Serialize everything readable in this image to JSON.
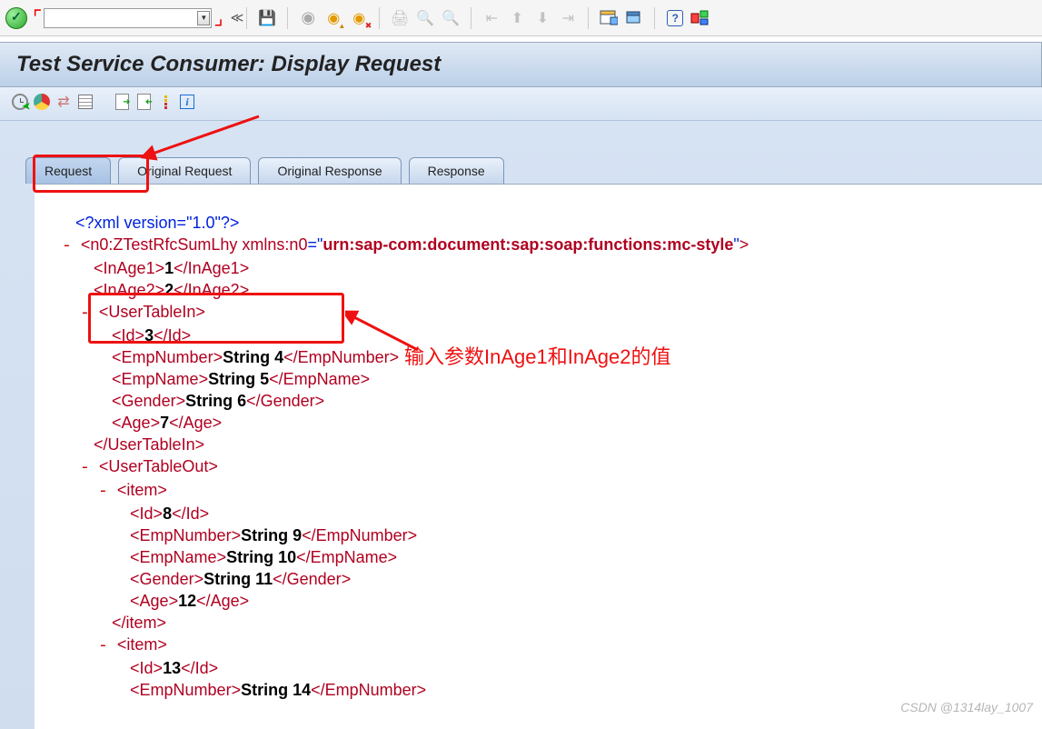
{
  "toolbar": {
    "command_value": "",
    "command_placeholder": ""
  },
  "title": "Test Service Consumer: Display Request",
  "tabs": {
    "request": "Request",
    "original_request": "Original Request",
    "original_response": "Original Response",
    "response": "Response"
  },
  "xml": {
    "declaration": "<?xml version=\"1.0\"?>",
    "root_open": "<n0:ZTestRfcSumLhy",
    "root_attr_name": "xmlns:n0",
    "root_attr_value": "urn:sap-com:document:sap:soap:functions:mc-style",
    "inage1_tag": "InAge1",
    "inage1_val": "1",
    "inage2_tag": "InAge2",
    "inage2_val": "2",
    "usertablein": "UserTableIn",
    "id": "Id",
    "id_val_3": "3",
    "empnumber": "EmpNumber",
    "empnumber_val_4": "String 4",
    "empname": "EmpName",
    "empname_val_5": "String 5",
    "gender": "Gender",
    "gender_val_6": "String 6",
    "age": "Age",
    "age_val_7": "7",
    "usertableout": "UserTableOut",
    "item": "item",
    "id_val_8": "8",
    "empnumber_val_9": "String 9",
    "empname_val_10": "String 10",
    "gender_val_11": "String 11",
    "age_val_12": "12",
    "id_val_13": "13",
    "empnumber_val_14": "String 14"
  },
  "annotation": "输入参数InAge1和InAge2的值",
  "watermark": "CSDN @1314lay_1007"
}
